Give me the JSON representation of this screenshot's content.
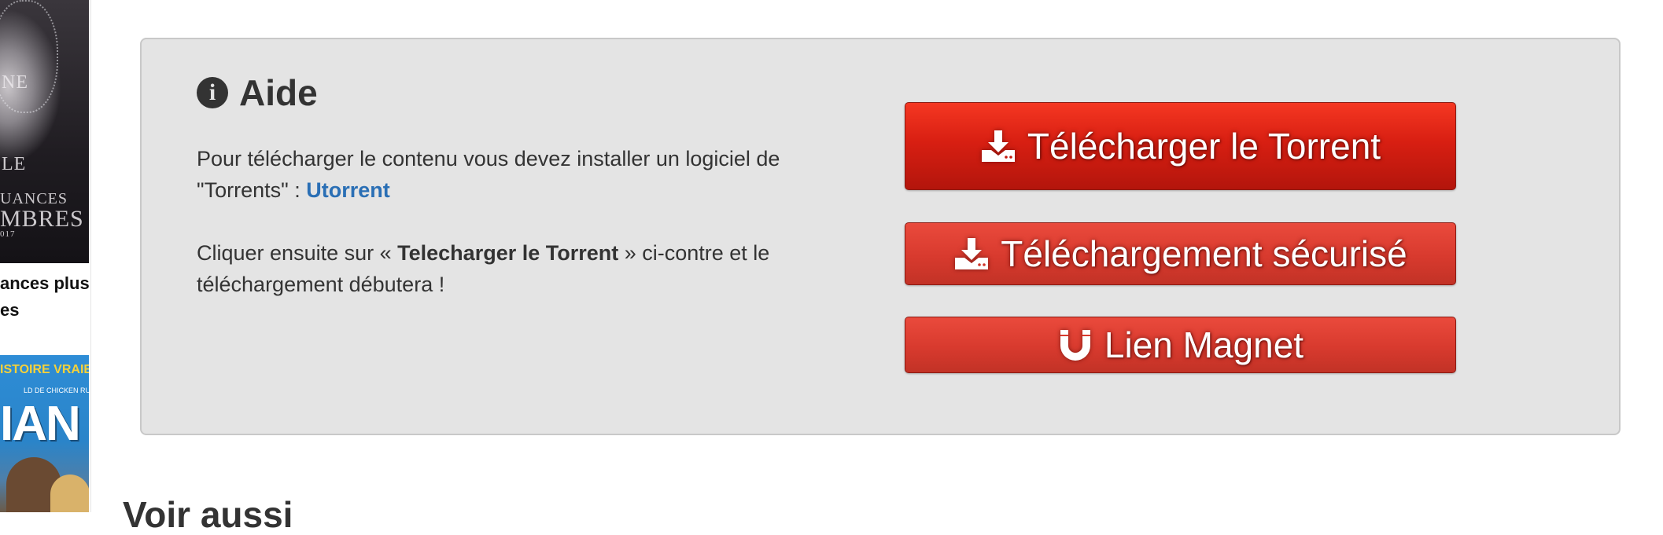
{
  "sidebar": {
    "poster_top": {
      "lines": [
        "NE",
        "LE",
        "UANCES",
        "MBRES",
        "017"
      ]
    },
    "title_lines": [
      "ances plus",
      "es"
    ],
    "poster_bottom": {
      "band": "ISTOIRE VRAIE",
      "small": "LD DE  CHICKEN RUN",
      "big": "IAN"
    }
  },
  "help": {
    "title": "Aide",
    "info_icon_glyph": "i",
    "para1_before": "Pour télécharger le contenu vous devez installer un logiciel de \"Torrents\" : ",
    "para1_link": "Utorrent",
    "para2_before": "Cliquer ensuite sur « ",
    "para2_bold": "Telecharger le Torrent",
    "para2_after": " » ci-contre et le téléchargement débutera !"
  },
  "buttons": {
    "torrent_label": "Télécharger le Torrent",
    "secure_label": "Téléchargement sécurisé",
    "magnet_label": "Lien Magnet"
  },
  "bottom_heading": "Voir aussi",
  "colors": {
    "panel_bg": "#e4e4e4",
    "primary_button": "#d81f12",
    "secondary_button": "#d83a2e",
    "link": "#2a6fb5"
  },
  "icons": {
    "title": "info-circle-icon",
    "torrent": "download-icon",
    "secure": "download-icon",
    "magnet": "magnet-icon"
  }
}
